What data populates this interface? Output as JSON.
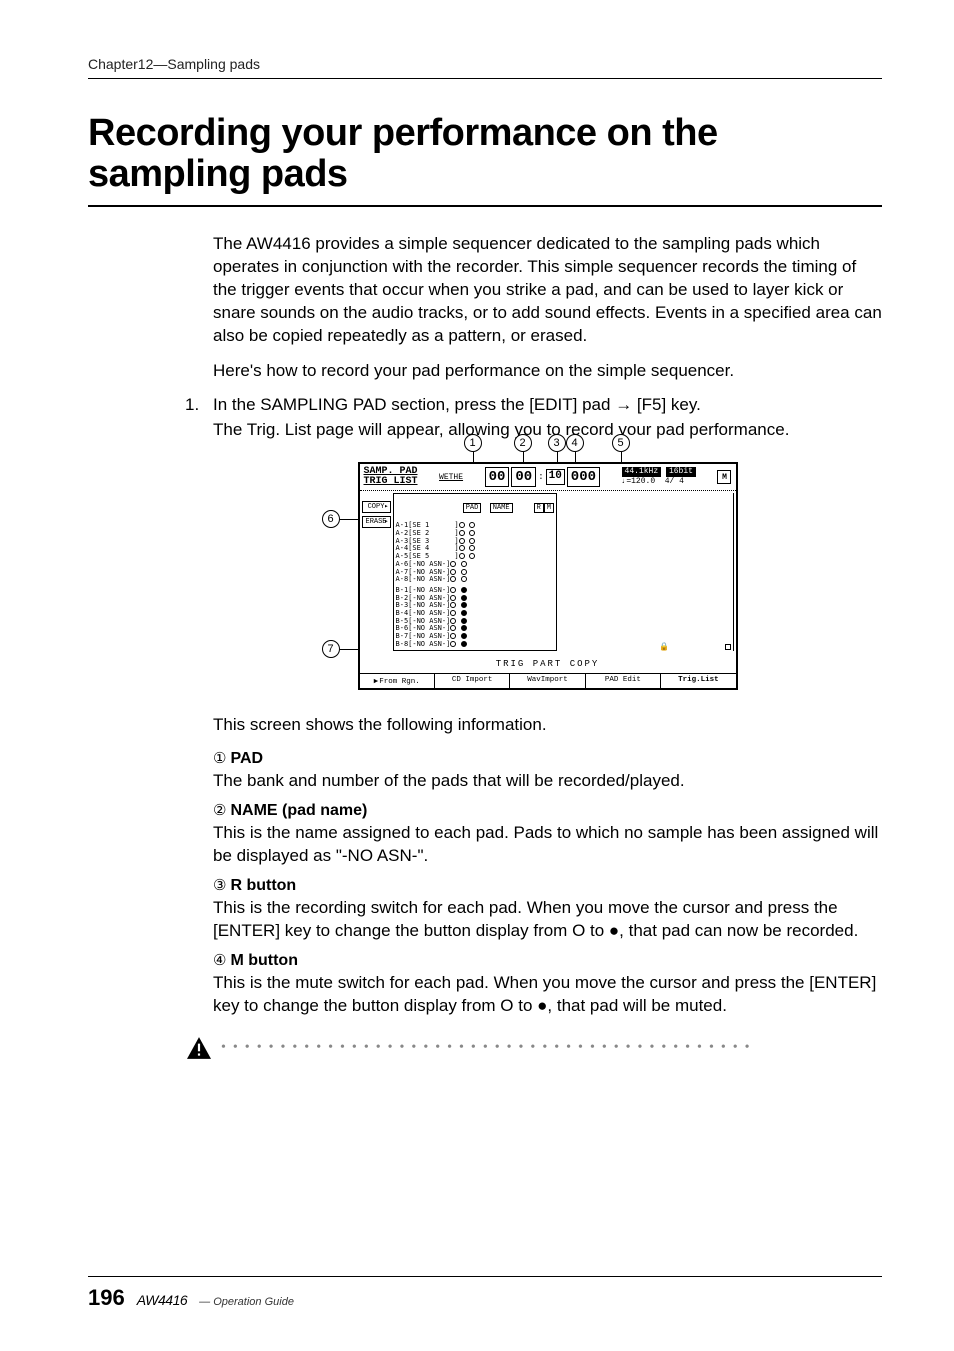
{
  "header": {
    "chapter": "Chapter12—Sampling pads"
  },
  "title": "Recording your performance on the sampling pads",
  "intro1": "The AW4416 provides a simple sequencer dedicated to the sampling pads which operates in conjunction with the recorder. This simple sequencer records the timing of the trigger events that occur when you strike a pad, and can be used to layer kick or snare sounds on the audio tracks, or to add sound effects. Events in a specified area can also be copied repeatedly as a pattern, or erased.",
  "intro2": "Here's how to record your pad performance on the simple sequencer.",
  "step": {
    "num": "1.",
    "head": "In the SAMPLING PAD section, press the [EDIT] pad → [F5] key.",
    "body": "The Trig. List page will appear, allowing you to record your pad performance."
  },
  "callouts": {
    "c1": "1",
    "c2": "2",
    "c3": "3",
    "c4": "4",
    "c5": "5",
    "c6": "6",
    "c7": "7"
  },
  "screen": {
    "title1": "SAMP. PAD",
    "title2": "TRIG LIST",
    "scene": "WETHE",
    "counter": {
      "a": "00",
      "b": "00",
      "c": "10",
      "d": "000"
    },
    "rate": "44.1kHz",
    "bit": "16bit",
    "tempo": "♩=120.0",
    "sig": "4/ 4",
    "mbox": "M",
    "side": {
      "copy": "COPY",
      "erase": "ERASE"
    },
    "cols": {
      "pad": "PAD",
      "name": "NAME",
      "r": "R",
      "m": "M"
    },
    "rows": [
      {
        "pad": "A-1",
        "name": "[SE 1      ]"
      },
      {
        "pad": "A-2",
        "name": "[SE 2      ]"
      },
      {
        "pad": "A-3",
        "name": "[SE 3      ]"
      },
      {
        "pad": "A-4",
        "name": "[SE 4      ]"
      },
      {
        "pad": "A-5",
        "name": "[SE 5      ]"
      },
      {
        "pad": "A-6",
        "name": "[-NO ASN-]"
      },
      {
        "pad": "A-7",
        "name": "[-NO ASN-]"
      },
      {
        "pad": "A-8",
        "name": "[-NO ASN-]"
      },
      {
        "pad": "B-1",
        "name": "[-NO ASN-]"
      },
      {
        "pad": "B-2",
        "name": "[-NO ASN-]"
      },
      {
        "pad": "B-3",
        "name": "[-NO ASN-]"
      },
      {
        "pad": "B-4",
        "name": "[-NO ASN-]"
      },
      {
        "pad": "B-5",
        "name": "[-NO ASN-]"
      },
      {
        "pad": "B-6",
        "name": "[-NO ASN-]"
      },
      {
        "pad": "B-7",
        "name": "[-NO ASN-]"
      },
      {
        "pad": "B-8",
        "name": "[-NO ASN-]"
      }
    ],
    "trig_label": "TRIG PART COPY",
    "tabs": [
      "From Rgn.",
      "CD Import",
      "WavImport",
      "PAD Edit",
      "Trig.List"
    ]
  },
  "after_fig": "This screen shows the following information.",
  "items": [
    {
      "num": "①",
      "label": "PAD",
      "text": "The bank and number of the pads that will be recorded/played."
    },
    {
      "num": "②",
      "label": "NAME (pad name)",
      "text": "This is the name assigned to each pad. Pads to which no sample has been assigned will be displayed as \"-NO ASN-\"."
    },
    {
      "num": "③",
      "label": "R button",
      "text": "This is the recording switch for each pad. When you move the cursor and press the [ENTER] key to change the button display from O to ●, that pad can now be recorded."
    },
    {
      "num": "④",
      "label": "M button",
      "text": "This is the mute switch for each pad. When you move the cursor and press the [ENTER] key to change the button display from O to ●, that pad will be muted."
    }
  ],
  "footer": {
    "page": "196",
    "model": "AW4416",
    "guide": "— Operation Guide"
  }
}
